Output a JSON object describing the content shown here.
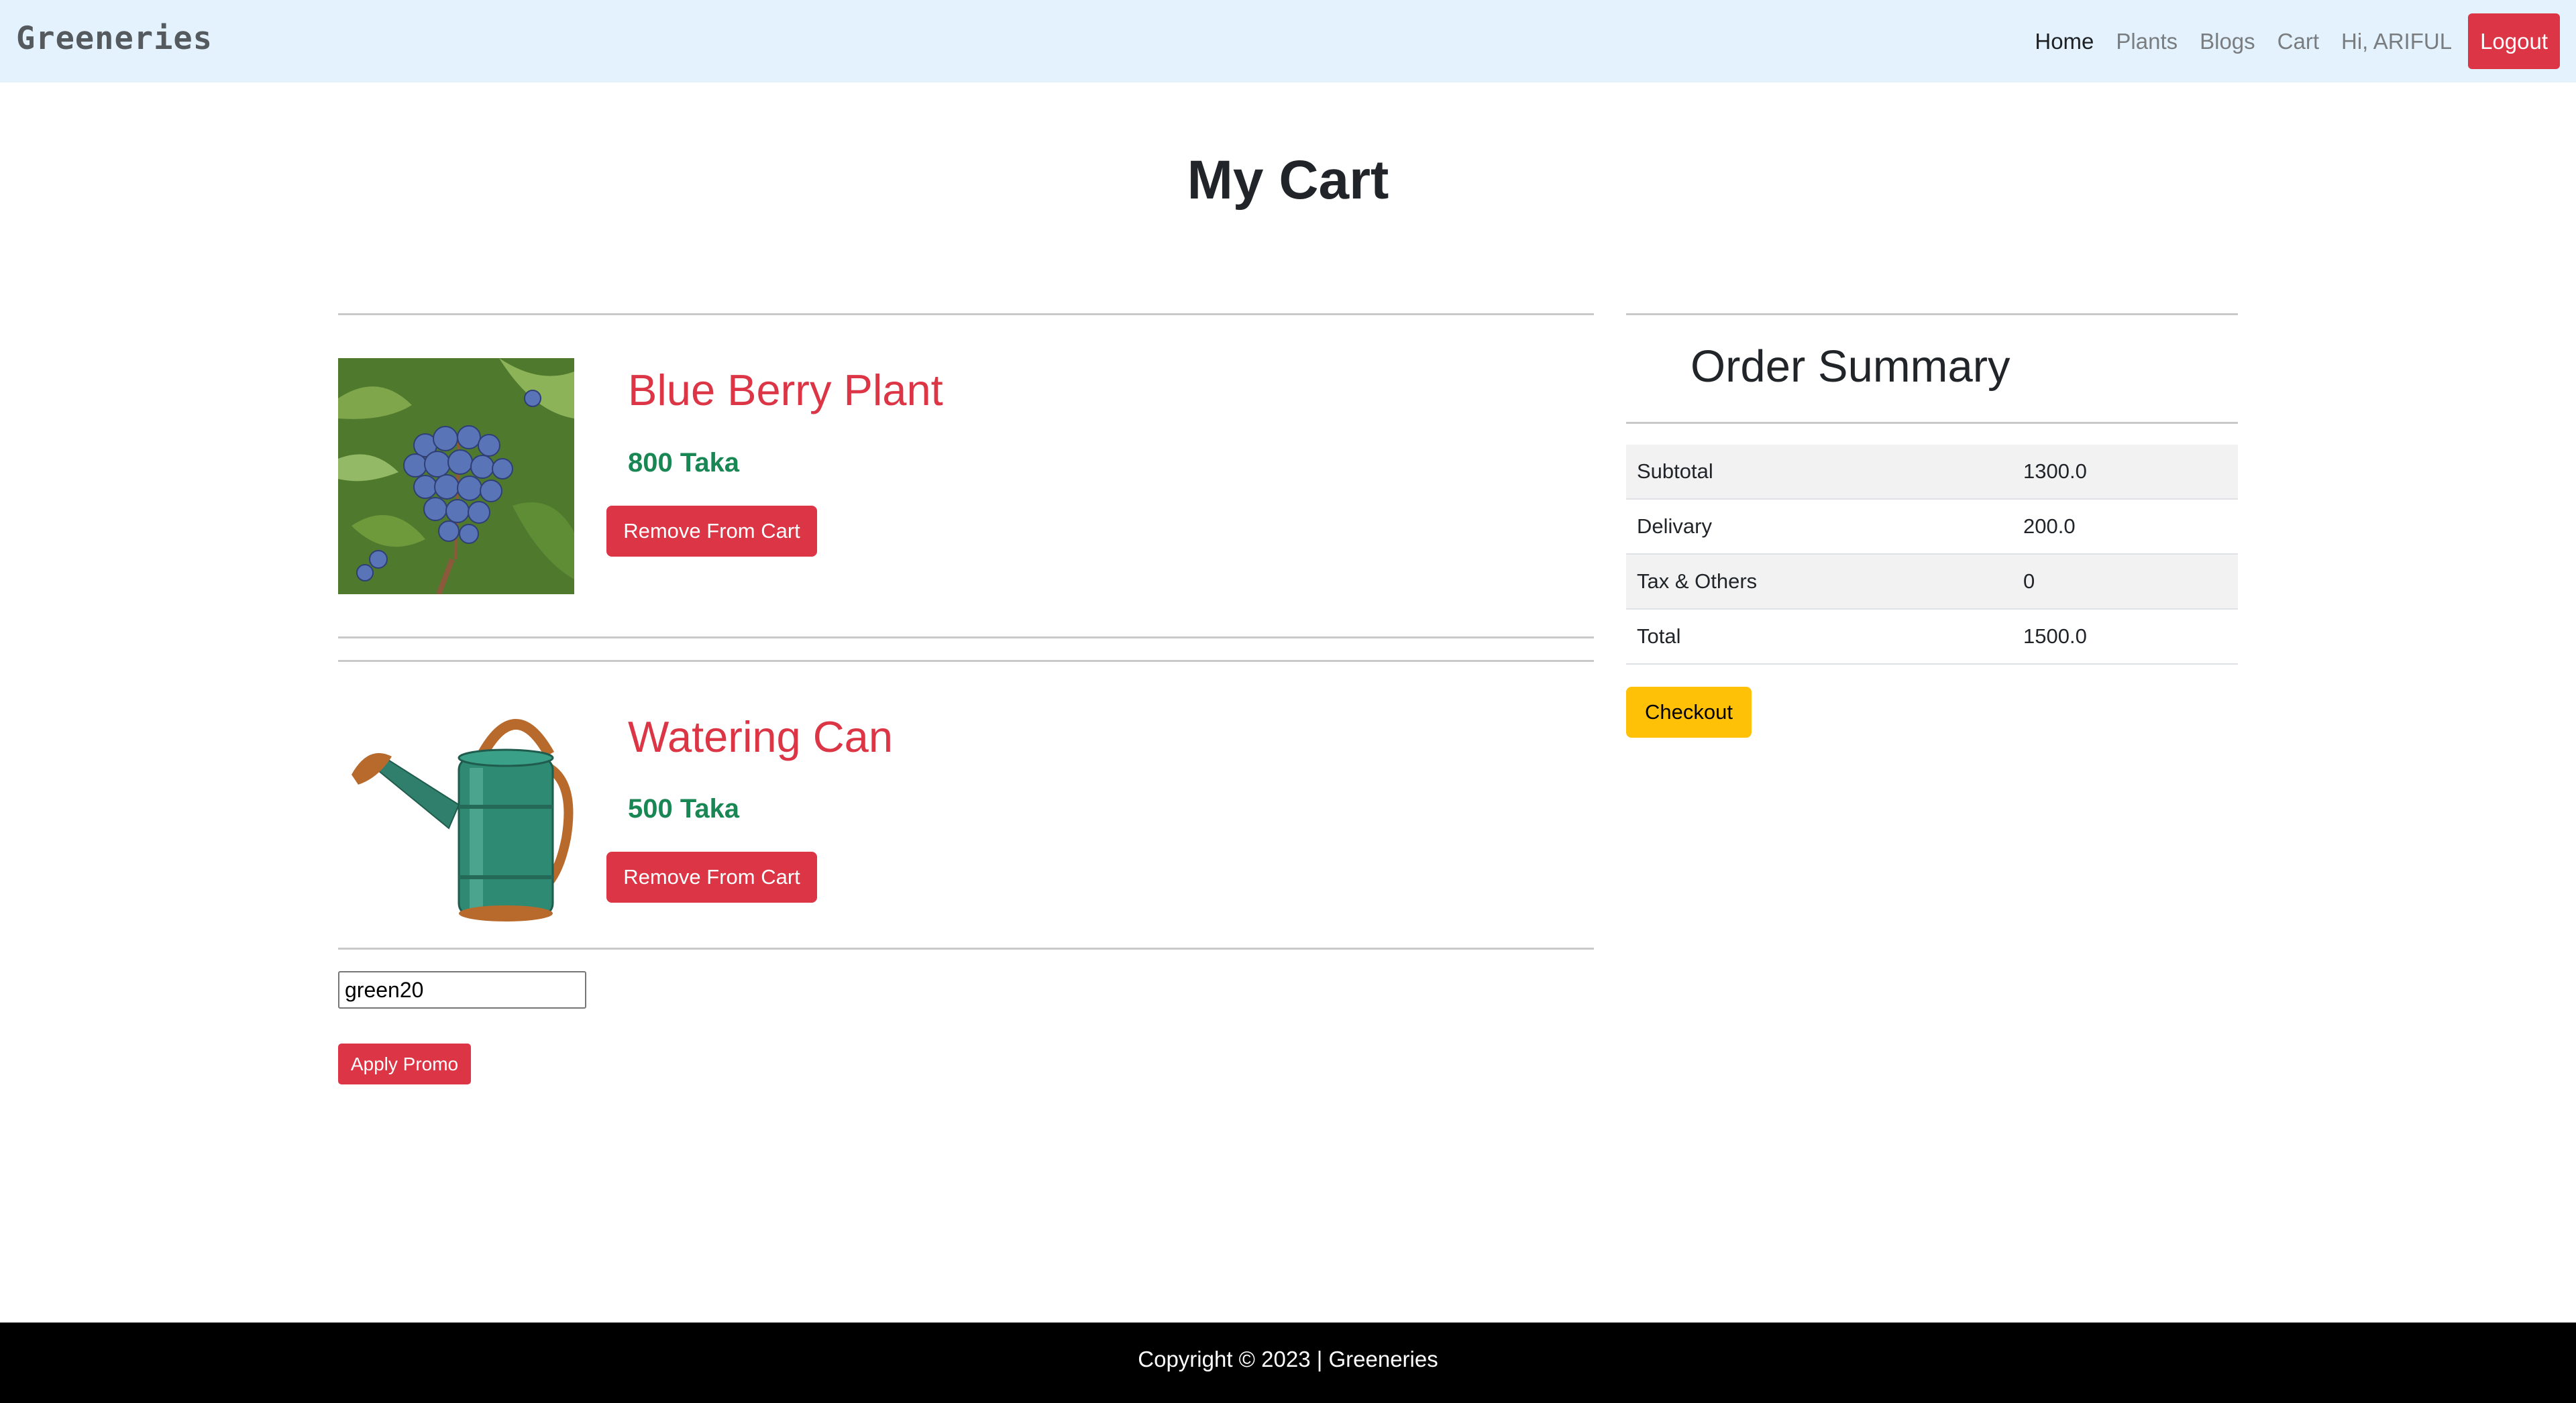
{
  "navbar": {
    "brand": "Greeneries",
    "links": [
      "Home",
      "Plants",
      "Blogs",
      "Cart"
    ],
    "greeting": "Hi, ARIFUL",
    "logout_label": "Logout"
  },
  "page_title": "My Cart",
  "cart_items": [
    {
      "name": "Blue Berry Plant",
      "price": "800 Taka",
      "remove_label": "Remove From Cart",
      "image": "blueberry-plant-photo"
    },
    {
      "name": "Watering Can",
      "price": "500 Taka",
      "remove_label": "Remove From Cart",
      "image": "watering-can-photo"
    }
  ],
  "promo": {
    "value": "green20",
    "apply_label": "Apply Promo"
  },
  "summary": {
    "title": "Order Summary",
    "rows": [
      {
        "label": "Subtotal",
        "value": "1300.0"
      },
      {
        "label": "Delivary",
        "value": "200.0"
      },
      {
        "label": "Tax & Others",
        "value": "0"
      },
      {
        "label": "Total",
        "value": "1500.0"
      }
    ],
    "checkout_label": "Checkout"
  },
  "footer": {
    "text": "Copyright © 2023 | Greeneries"
  },
  "colors": {
    "navbar_bg": "#e3f2fd",
    "danger": "#dc3545",
    "success": "#198754",
    "warning": "#ffc107",
    "footer_bg": "#000000"
  }
}
